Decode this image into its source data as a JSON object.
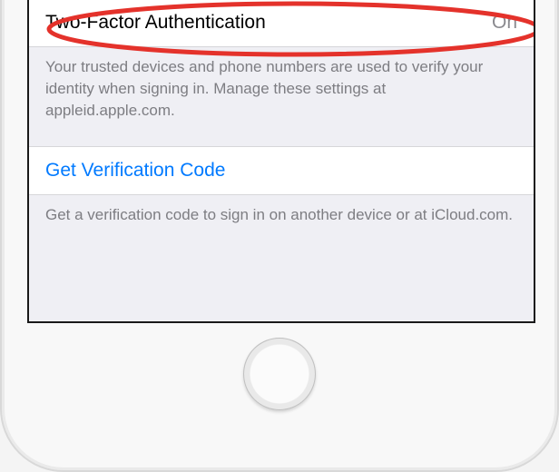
{
  "section1": {
    "label": "Two-Factor Authentication",
    "value": "On",
    "footer": "Your trusted devices and phone numbers are used to verify your identity when signing in. Manage these settings at appleid.apple.com."
  },
  "section2": {
    "link": "Get Verification Code",
    "footer": "Get a verification code to sign in on another device or at iCloud.com."
  }
}
